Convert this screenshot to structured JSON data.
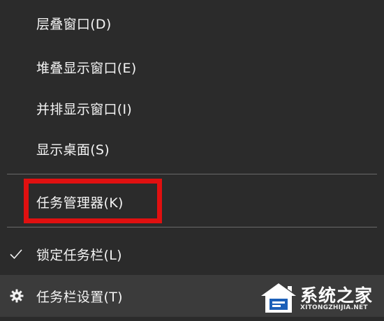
{
  "menu": {
    "items": [
      {
        "label": "层叠窗口(D)"
      },
      {
        "label": "堆叠显示窗口(E)"
      },
      {
        "label": "并排显示窗口(I)"
      },
      {
        "label": "显示桌面(S)"
      },
      {
        "label": "任务管理器(K)"
      },
      {
        "label": "锁定任务栏(L)",
        "checked": true,
        "icon": "check-icon"
      },
      {
        "label": "任务栏设置(T)",
        "icon": "gear-icon"
      }
    ]
  },
  "colors": {
    "background": "#2b2b2b",
    "text": "#f4f4f4",
    "separator": "#6a6a6a",
    "highlight": "#e01010",
    "hover_row": "#3b3b3b"
  },
  "watermark": {
    "brand": "系统之家",
    "url": "XITONGZHIJIA.NET",
    "icon": "house-logo-icon"
  }
}
